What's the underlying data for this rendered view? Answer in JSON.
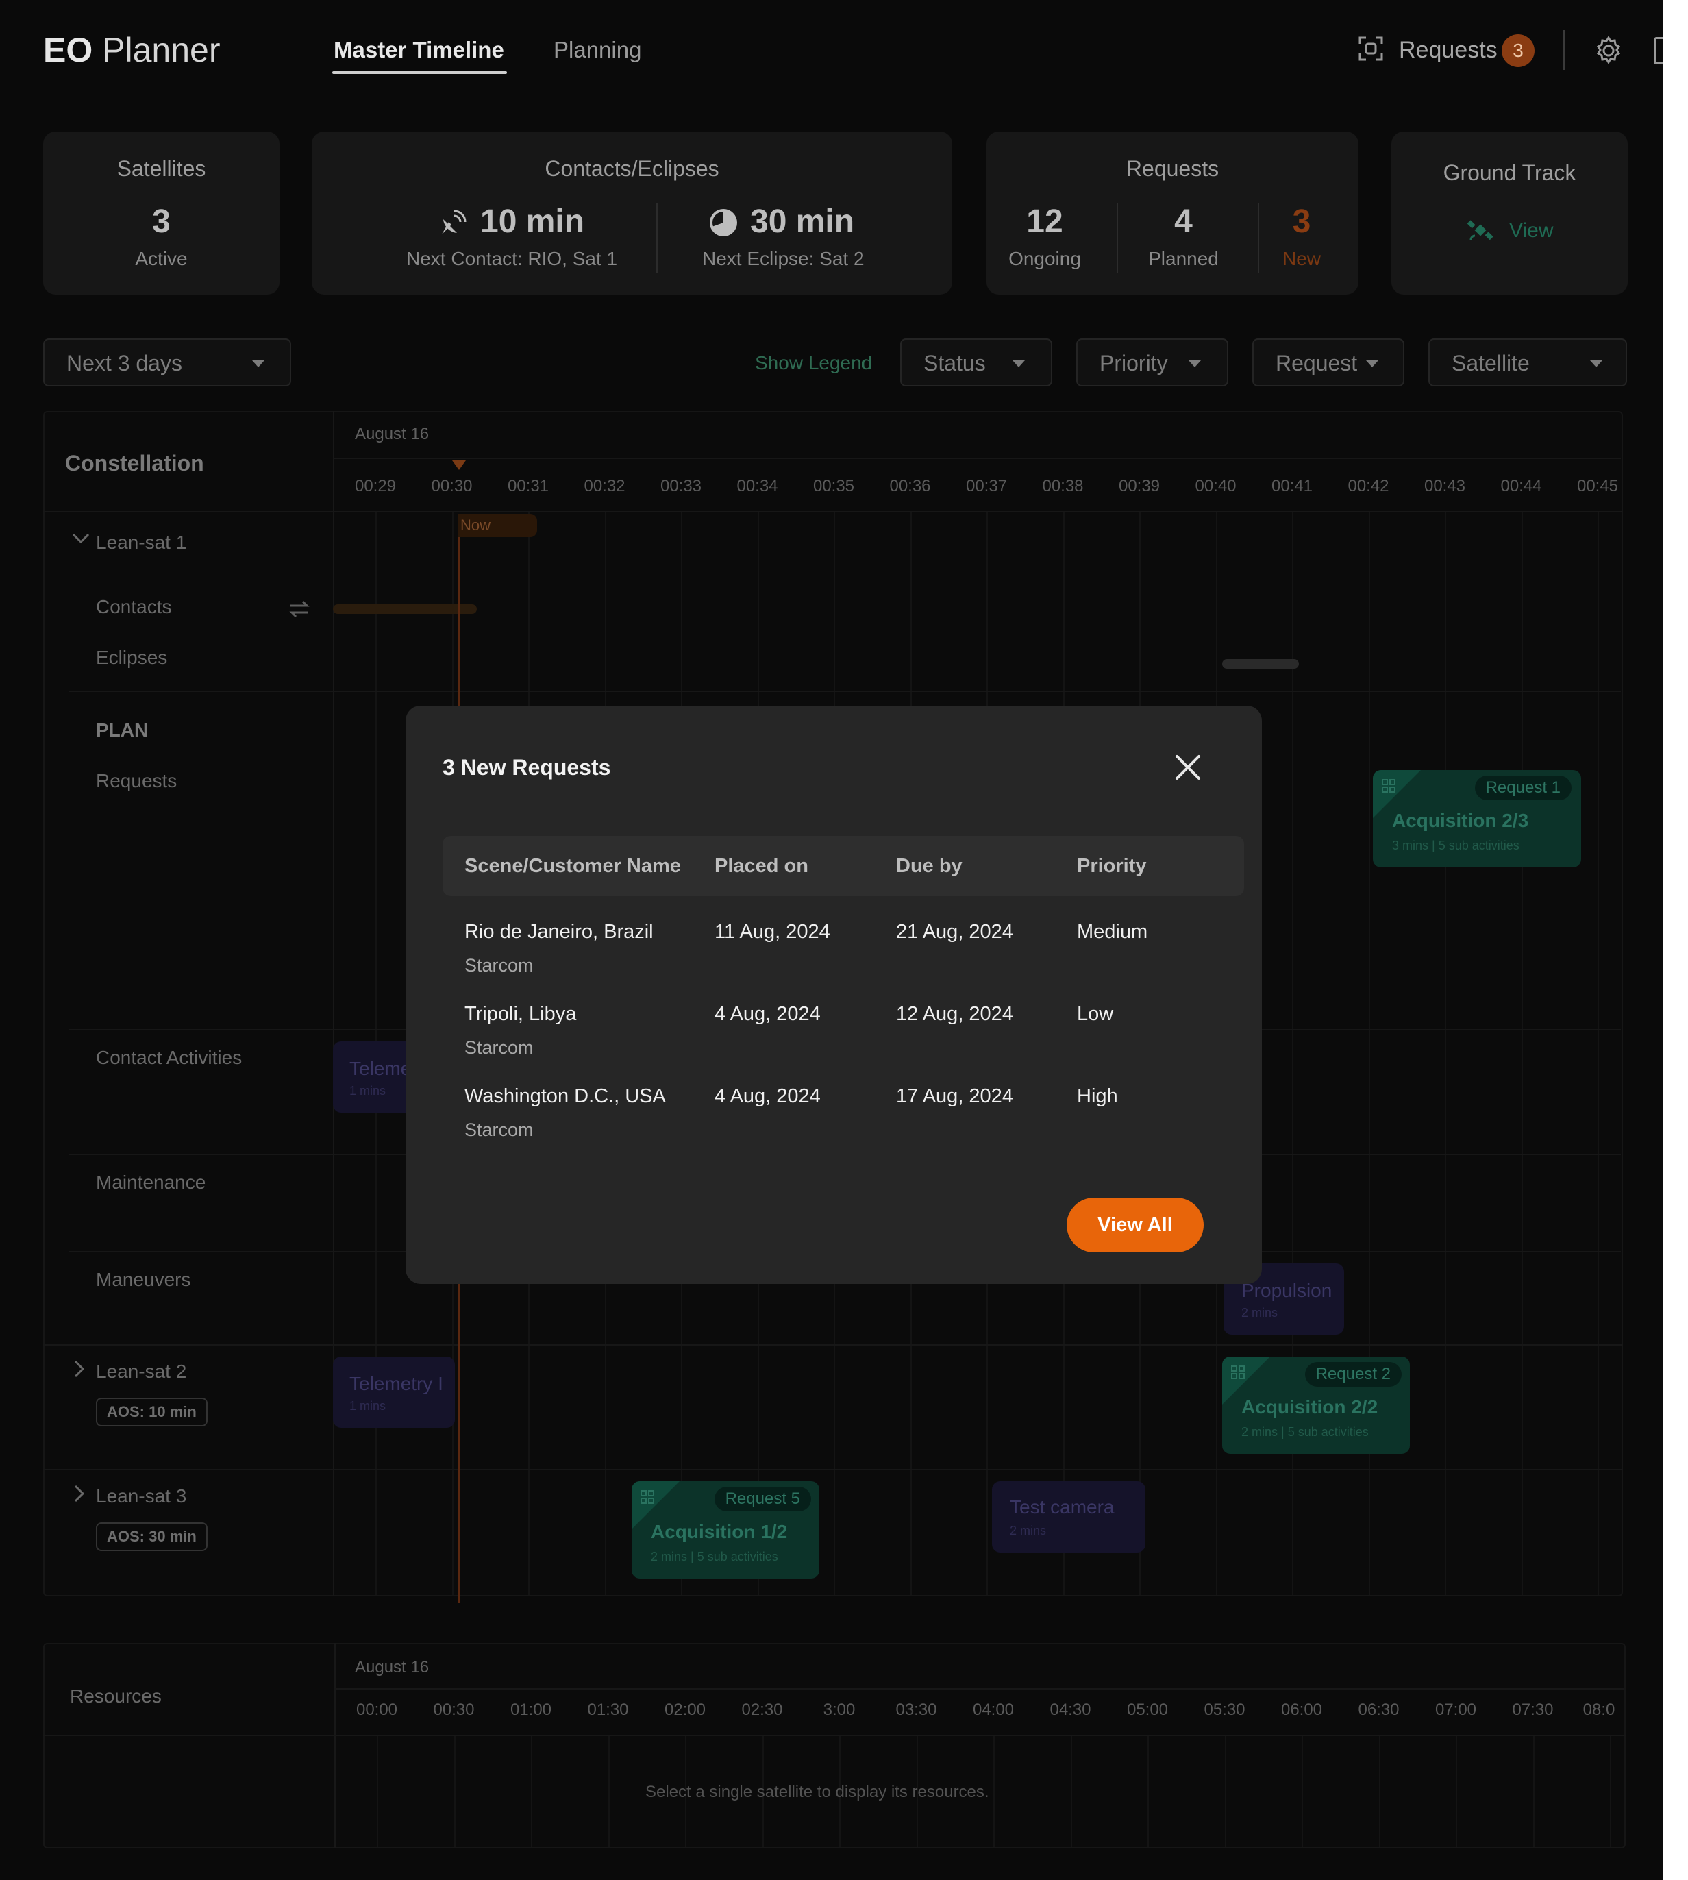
{
  "brand": {
    "bold": "EO",
    "rest": " Planner"
  },
  "nav": {
    "tabs": [
      {
        "label": "Master Timeline",
        "active": true
      },
      {
        "label": "Planning",
        "active": false
      }
    ]
  },
  "header": {
    "requests_label": "Requests",
    "requests_count": "3",
    "icons": [
      "scan-icon",
      "gear-icon",
      "panel-icon"
    ]
  },
  "stats": {
    "satellites": {
      "title": "Satellites",
      "value": "3",
      "label": "Active"
    },
    "contacts": {
      "title": "Contacts/Eclipses",
      "contact_value": "10 min",
      "contact_label": "Next Contact: RIO, Sat 1",
      "eclipse_value": "30 min",
      "eclipse_label": "Next Eclipse: Sat 2"
    },
    "requests": {
      "title": "Requests",
      "ongoing_value": "12",
      "ongoing_label": "Ongoing",
      "planned_value": "4",
      "planned_label": "Planned",
      "new_value": "3",
      "new_label": "New"
    },
    "ground_track": {
      "title": "Ground Track",
      "link": "View"
    }
  },
  "filters": {
    "range": "Next 3 days",
    "show_legend": "Show Legend",
    "status": "Status",
    "priority": "Priority",
    "request": "Request",
    "satellite": "Satellite"
  },
  "timeline": {
    "date": "August 16",
    "title": "Constellation",
    "ticks": [
      "00:29",
      "00:30",
      "00:31",
      "00:32",
      "00:33",
      "00:34",
      "00:35",
      "00:36",
      "00:37",
      "00:38",
      "00:39",
      "00:40",
      "00:41",
      "00:42",
      "00:43",
      "00:44",
      "00:45"
    ],
    "now": "Now",
    "rows": {
      "sat1": "Lean-sat 1",
      "contacts": "Contacts",
      "eclipses": "Eclipses",
      "plan": "PLAN",
      "requests": "Requests",
      "contact_activities": "Contact Activities",
      "maintenance": "Maintenance",
      "maneuvers": "Maneuvers",
      "sat2": "Lean-sat 2",
      "sat2_aos": "AOS: 10 min",
      "sat3": "Lean-sat 3",
      "sat3_aos": "AOS: 30 min"
    },
    "activities": {
      "req1": {
        "pill": "Request 1",
        "title": "Acquisition 2/3",
        "sub": "3 mins | 5 sub activities"
      },
      "req2": {
        "pill": "Request 2",
        "title": "Acquisition 2/2",
        "sub": "2 mins | 5 sub activities"
      },
      "req5": {
        "pill": "Request 5",
        "title": "Acquisition 1/2",
        "sub": "2 mins | 5 sub activities"
      },
      "telemetry_a": {
        "title": "Teleme",
        "sub": "1 mins"
      },
      "telemetry_b": {
        "title": "Telemetry I",
        "sub": "1 mins"
      },
      "propulsion": {
        "title": "Propulsion",
        "sub": "2 mins"
      },
      "test_camera": {
        "title": "Test camera",
        "sub": "2 mins"
      }
    }
  },
  "resources": {
    "title": "Resources",
    "date": "August 16",
    "ticks": [
      "00:00",
      "00:30",
      "01:00",
      "01:30",
      "02:00",
      "02:30",
      "3:00",
      "03:30",
      "04:00",
      "04:30",
      "05:00",
      "05:30",
      "06:00",
      "06:30",
      "07:00",
      "07:30",
      "08:0"
    ],
    "message": "Select a single satellite to display its resources."
  },
  "modal": {
    "title": "3 New Requests",
    "columns": [
      "Scene/Customer Name",
      "Placed on",
      "Due by",
      "Priority"
    ],
    "rows": [
      {
        "name": "Rio de Janeiro, Brazil",
        "customer": "Starcom",
        "placed": "11 Aug, 2024",
        "due": "21 Aug, 2024",
        "priority": "Medium"
      },
      {
        "name": "Tripoli, Libya",
        "customer": "Starcom",
        "placed": "4 Aug, 2024",
        "due": "12 Aug, 2024",
        "priority": "Low"
      },
      {
        "name": "Washington D.C., USA",
        "customer": "Starcom",
        "placed": "4 Aug, 2024",
        "due": "17 Aug, 2024",
        "priority": "High"
      }
    ],
    "view_all": "View All"
  },
  "colors": {
    "accent": "#e8650a",
    "acquisition": "#0c3329",
    "maintenance": "#15132a"
  }
}
